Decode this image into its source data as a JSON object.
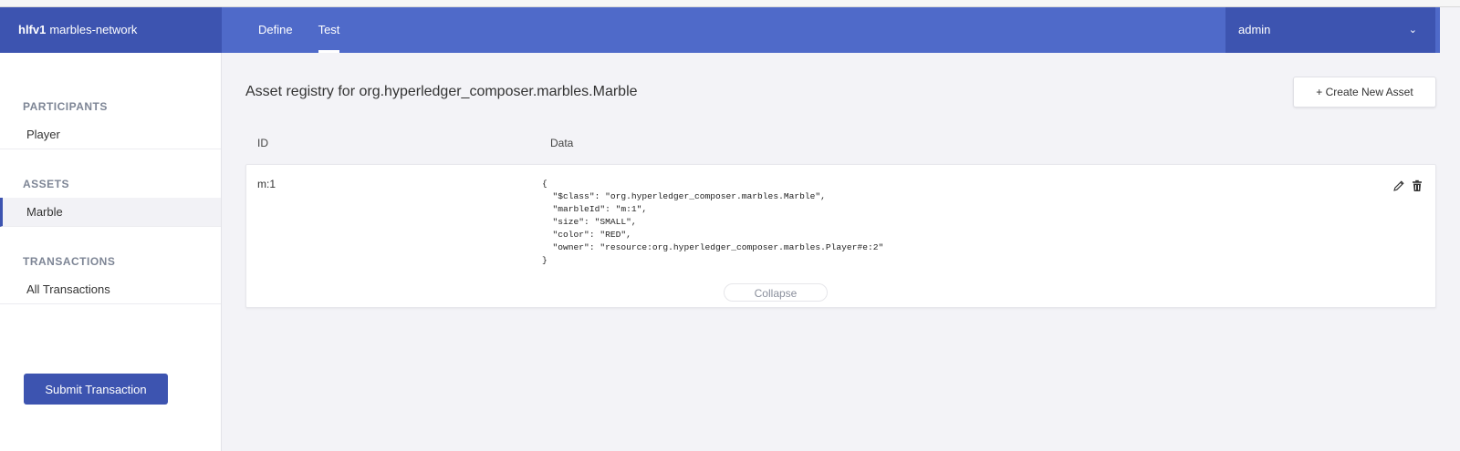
{
  "header": {
    "brand_bold": "hlfv1",
    "brand_name": "marbles-network",
    "tabs": [
      {
        "label": "Define"
      },
      {
        "label": "Test"
      }
    ],
    "user": "admin",
    "user_chevron": "⌄"
  },
  "sidebar": {
    "participants_title": "PARTICIPANTS",
    "participants": [
      "Player"
    ],
    "assets_title": "ASSETS",
    "assets": [
      "Marble"
    ],
    "transactions_title": "TRANSACTIONS",
    "transactions": [
      "All Transactions"
    ],
    "submit_label": "Submit Transaction"
  },
  "main": {
    "title": "Asset registry for org.hyperledger_composer.marbles.Marble",
    "create_label": "+ Create New Asset",
    "col_id": "ID",
    "col_data": "Data",
    "rows": [
      {
        "id": "m:1",
        "data": "{\n  \"$class\": \"org.hyperledger_composer.marbles.Marble\",\n  \"marbleId\": \"m:1\",\n  \"size\": \"SMALL\",\n  \"color\": \"RED\",\n  \"owner\": \"resource:org.hyperledger_composer.marbles.Player#e:2\"\n}",
        "collapse_label": "Collapse"
      }
    ]
  },
  "icons": {
    "edit": "pencil-icon",
    "delete": "trash-icon"
  },
  "colors": {
    "header": "#4f6ac9",
    "header_dark": "#3d54b0",
    "background": "#f3f3f7"
  }
}
